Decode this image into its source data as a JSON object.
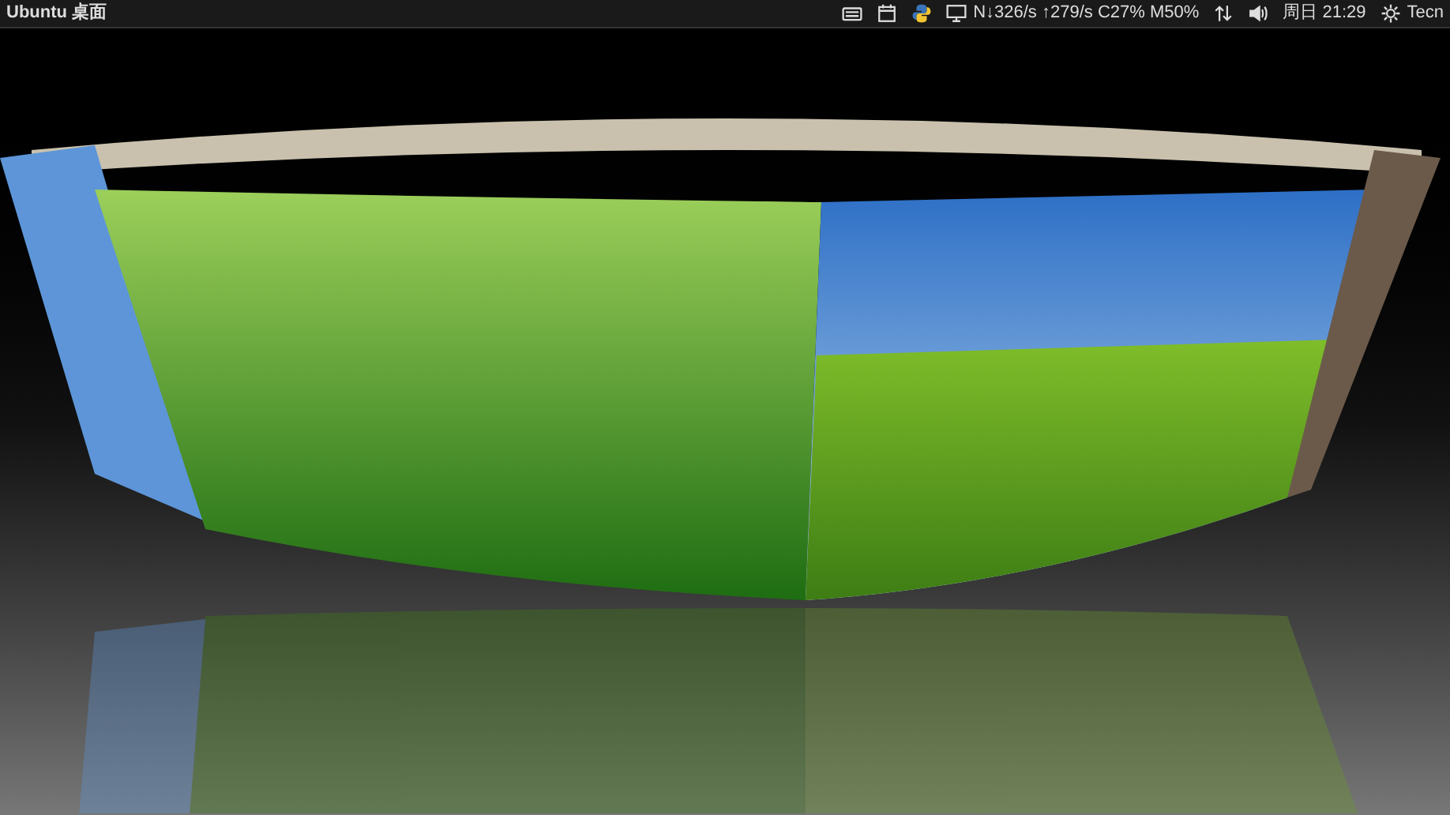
{
  "top_panel": {
    "title": "Ubuntu 桌面",
    "indicators": [
      {
        "kind": "keyboard"
      },
      {
        "kind": "calendar"
      },
      {
        "kind": "snake"
      },
      {
        "kind": "monitor",
        "text": "N↓326/s ↑279/s C27% M50%"
      },
      {
        "kind": "network"
      },
      {
        "kind": "volume"
      },
      {
        "kind": "clock",
        "text": "周日 21:29"
      },
      {
        "kind": "gear",
        "text": "Tecn"
      }
    ]
  }
}
